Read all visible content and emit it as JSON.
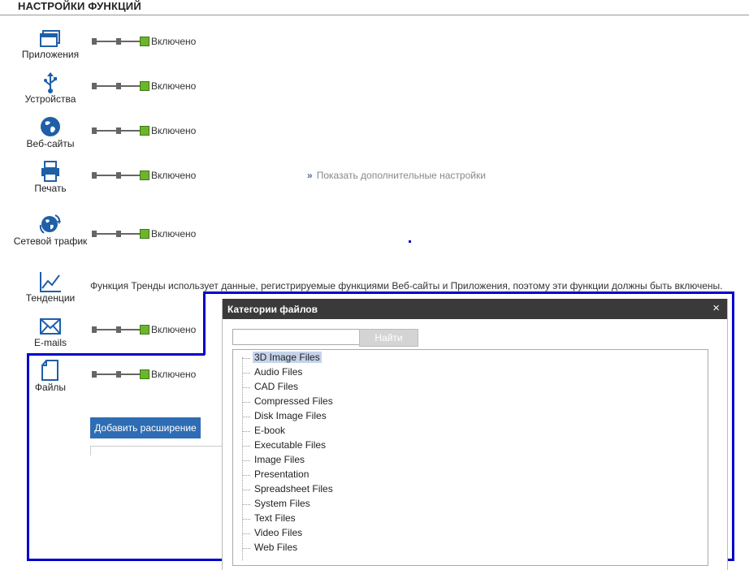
{
  "page_title": "НАСТРОЙКИ ФУНКЦИЙ",
  "features": [
    {
      "label": "Приложения",
      "icon": "window-icon",
      "state": "Включено",
      "enabled": true
    },
    {
      "label": "Устройства",
      "icon": "usb-icon",
      "state": "Включено",
      "enabled": true
    },
    {
      "label": "Веб-сайты",
      "icon": "globe-icon",
      "state": "Включено",
      "enabled": true
    },
    {
      "label": "Печать",
      "icon": "printer-icon",
      "state": "Включено",
      "enabled": true
    },
    {
      "label": "Сетевой трафик",
      "icon": "network-globe-icon",
      "state": "Включено",
      "enabled": true
    },
    {
      "label": "Тенденции",
      "icon": "line-chart-icon"
    },
    {
      "label": "E-mails",
      "icon": "envelope-icon",
      "state": "Включено",
      "enabled": true
    },
    {
      "label": "Файлы",
      "icon": "file-icon",
      "state": "Включено",
      "enabled": true
    }
  ],
  "more_settings_link": "Показать дополнительные настройки",
  "trends_note": "Функция Тренды использует данные, регистрируемые  функциями Веб-сайты и Приложения, поэтому эти функции должны быть включены.",
  "add_extension_button": "Добавить расширение",
  "dialog": {
    "title": "Категории файлов",
    "close": "×",
    "search_value": "",
    "find_button": "Найти",
    "categories": [
      "3D Image Files",
      "Audio Files",
      "CAD Files",
      "Compressed Files",
      "Disk Image Files",
      "E-book",
      "Executable Files",
      "Image Files",
      "Presentation",
      "Spreadsheet Files",
      "System Files",
      "Text Files",
      "Video Files",
      "Web Files"
    ],
    "selected_category": "3D Image Files"
  },
  "colors": {
    "accent": "#2e6db4",
    "toggle_on": "#6cb52d",
    "highlight_border": "#0000cc",
    "dialog_header": "#3a3a3a"
  }
}
